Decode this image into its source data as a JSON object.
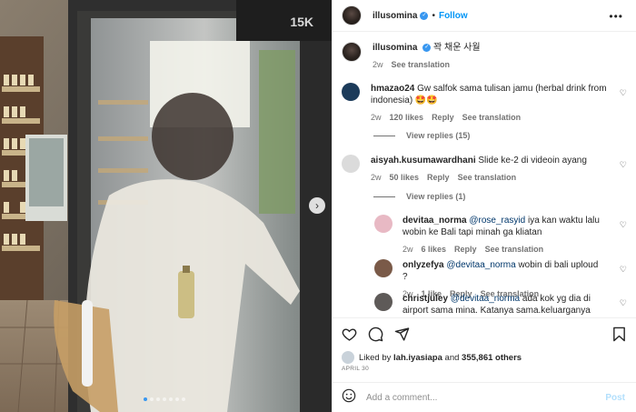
{
  "post": {
    "username": "illusomina",
    "follow_label": "Follow",
    "more_label": "•••",
    "separator": "•",
    "photo_slides": 7,
    "active_slide": 0,
    "photo_sign_text": "15K"
  },
  "caption": {
    "username": "illusomina",
    "text": "꽉 채운 사월",
    "age": "2w",
    "translate_label": "See translation"
  },
  "comments": [
    {
      "username": "hmazao24",
      "text": "Gw salfok sama tulisan jamu (herbal drink from indonesia) 🤩🤩",
      "age": "2w",
      "likes": "120 likes",
      "reply_label": "Reply",
      "translate_label": "See translation",
      "view_replies": "View replies (15)",
      "avatar_color": "#1c3b5a"
    },
    {
      "username": "aisyah.kusumawardhani",
      "text": "Slide ke-2 di videoin ayang",
      "age": "2w",
      "likes": "50 likes",
      "reply_label": "Reply",
      "translate_label": "See translation",
      "view_replies": "View replies (1)",
      "avatar_color": "#dbdbdb"
    }
  ],
  "replies": [
    {
      "username": "devitaa_norma",
      "mention": "@rose_rasyid",
      "text": "iya kan waktu lalu wobin ke Bali tapi minah ga kliatan",
      "age": "2w",
      "likes": "6 likes",
      "reply_label": "Reply",
      "translate_label": "See translation",
      "avatar_color": "#e8b9c4"
    },
    {
      "username": "onlyzefya",
      "mention": "@devitaa_norma",
      "text": "wobin di bali uploud ?",
      "age": "2w",
      "likes": "1 like",
      "reply_label": "Reply",
      "translate_label": "See translation",
      "avatar_color": "#7a5a48"
    },
    {
      "username": "christjuley",
      "mention": "@devitaa_norma",
      "text": "ada kok yg dia di airport sama mina. Katanya sama.keluarganya juga cuma yg",
      "avatar_color": "#5e5a58"
    }
  ],
  "actions": {
    "liked_by_prefix": "Liked by",
    "liked_by_user": "lah.iyasiapa",
    "liked_by_and": "and",
    "others": "355,861 others",
    "date": "APRIL 30"
  },
  "composer": {
    "placeholder": "Add a comment...",
    "post_label": "Post"
  },
  "colors": {
    "link_blue": "#0095f6",
    "verified_blue": "#3897f0",
    "post_disabled": "#b2dffc",
    "mention": "#00376b"
  }
}
